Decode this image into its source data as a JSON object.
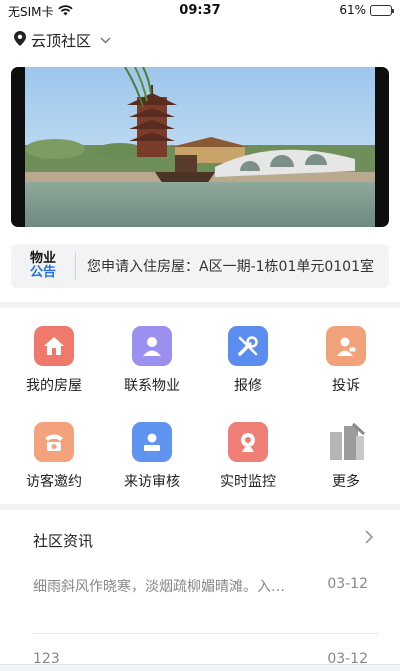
{
  "status_bar": {
    "carrier": "无SIM卡",
    "time": "09:37",
    "battery_text": "61%",
    "battery_level": 0.61
  },
  "location": {
    "name": "云顶社区",
    "icon": "location-pin-icon",
    "dropdown_icon": "chevron-down-icon"
  },
  "banner": {
    "slide_count": 5,
    "active_slide": 4
  },
  "notice": {
    "badge_line1": "物业",
    "badge_line2": "公告",
    "text": "您申请入住房屋：A区一期-1栋01单元0101室"
  },
  "services": [
    {
      "label": "我的房屋",
      "icon": "house-icon",
      "color": "#ef7a6b"
    },
    {
      "label": "联系物业",
      "icon": "person-icon",
      "color": "#9b8ff0"
    },
    {
      "label": "报修",
      "icon": "wrench-icon",
      "color": "#5b8df0"
    },
    {
      "label": "投诉",
      "icon": "complaint-person-icon",
      "color": "#f2a27a"
    },
    {
      "label": "访客邀约",
      "icon": "phone-icon",
      "color": "#f3a27c"
    },
    {
      "label": "来访审核",
      "icon": "visitor-review-icon",
      "color": "#5e93f0"
    },
    {
      "label": "实时监控",
      "icon": "camera-icon",
      "color": "#ef7f76"
    },
    {
      "label": "更多",
      "icon": "buildings-icon",
      "color": "#bfbfbf"
    }
  ],
  "news": {
    "title": "社区资讯",
    "more_icon": "chevron-right-icon",
    "items": [
      {
        "text": "细雨斜风作晓寒，淡烟疏柳媚晴滩。入淮清洛渐漫漫",
        "date": "03-12"
      },
      {
        "text": "123",
        "date": "03-12"
      }
    ]
  }
}
